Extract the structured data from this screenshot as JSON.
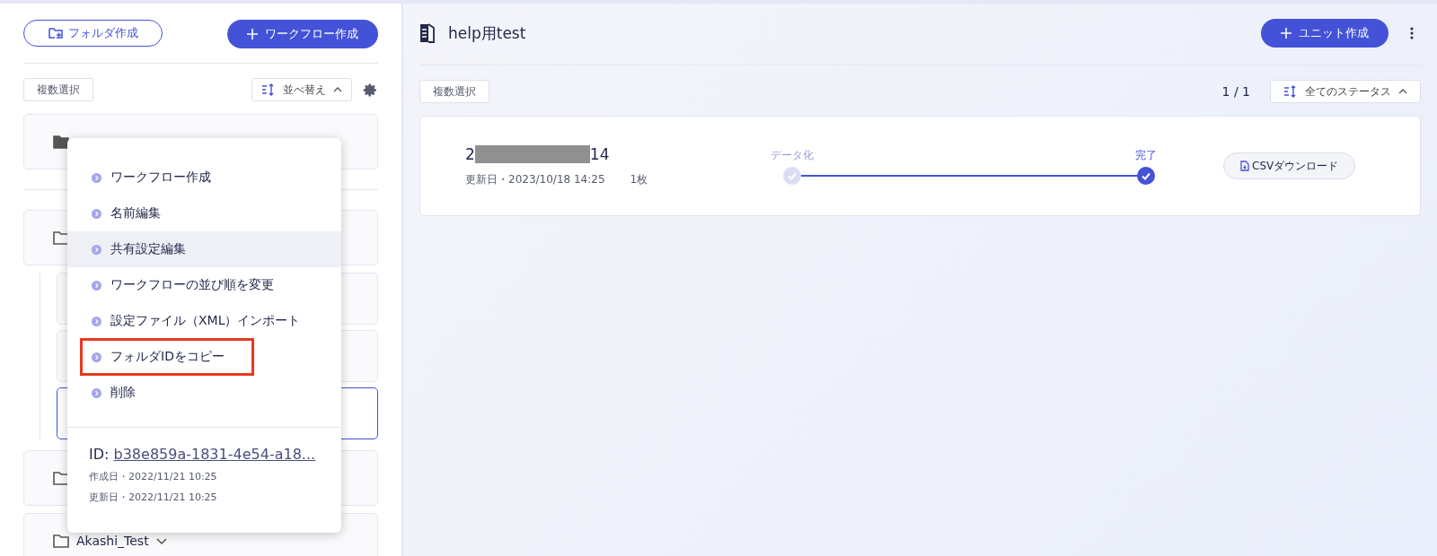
{
  "sidebar": {
    "create_folder_button": "フォルダ作成",
    "create_workflow_button": "ワークフロー作成",
    "multi_select_button": "複数選択",
    "sort_button": "並べ替え",
    "folders": [
      {
        "filled": true,
        "selected": false
      },
      {
        "filled": false,
        "selected": false,
        "children": [
          {
            "selected": false
          },
          {
            "selected": false
          },
          {
            "selected": true
          }
        ]
      },
      {
        "filled": false,
        "selected": false
      },
      {
        "filled": false,
        "name": "Akashi_Test",
        "selected": false
      }
    ]
  },
  "context_menu": {
    "items": [
      {
        "label": "ワークフロー作成",
        "hovered": false,
        "highlighted": false
      },
      {
        "label": "名前編集",
        "hovered": false,
        "highlighted": false
      },
      {
        "label": "共有設定編集",
        "hovered": true,
        "highlighted": false
      },
      {
        "label": "ワークフローの並び順を変更",
        "hovered": false,
        "highlighted": false
      },
      {
        "label": "設定ファイル（XML）インポート",
        "hovered": false,
        "highlighted": false
      },
      {
        "label": "フォルダIDをコピー",
        "hovered": false,
        "highlighted": true
      },
      {
        "label": "削除",
        "hovered": false,
        "highlighted": false
      }
    ],
    "id_label": "ID:",
    "id_value": "b38e859a-1831-4e54-a18...",
    "created": "作成日・2022/11/21 10:25",
    "updated": "更新日・2022/11/21 10:25"
  },
  "main": {
    "title": "help用test",
    "create_unit_button": "ユニット作成",
    "multi_select_button": "複数選択",
    "pagination": "1 / 1",
    "status_filter": "全てのステータス",
    "units": [
      {
        "title_start": "2",
        "title_end": "14",
        "redacted": true,
        "updated": "更新日・2023/10/18 14:25",
        "pages": "1枚",
        "steps": [
          {
            "label": "データ化",
            "selected": false
          },
          {
            "label": "完了",
            "selected": true
          }
        ],
        "download_button": "CSVダウンロード"
      }
    ]
  }
}
